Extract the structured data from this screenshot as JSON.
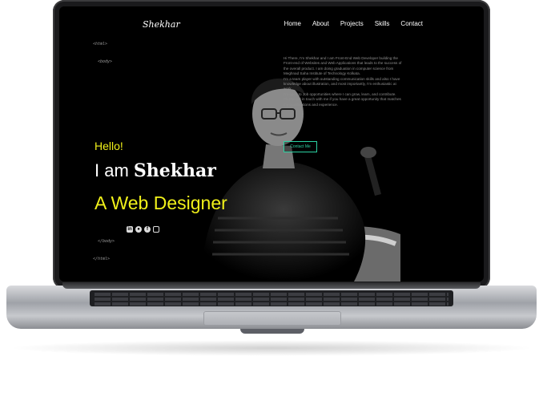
{
  "site": {
    "logo": "Shekhar",
    "nav": [
      "Home",
      "About",
      "Projects",
      "Skills",
      "Contact"
    ]
  },
  "hero": {
    "greeting": "Hello!",
    "intro_prefix": "I am",
    "name": "Shekhar",
    "role": "A Web Designer",
    "social_icons": [
      "linkedin-icon",
      "github-icon",
      "facebook-icon",
      "instagram-icon"
    ]
  },
  "code_tags": {
    "html_open": "<html>",
    "body_open": "<body>",
    "body_close": "</body>",
    "html_close": "</html>"
  },
  "about": {
    "lines": [
      "Hi There, I'm Shekhar and I am Front-End Web Developer building the",
      "Front-end of Websites and Web Applications that leads to the success of",
      "the overall product. I am doing graduation in computer science from",
      "Meghnad Saha Institute of Technology Kolkata.",
      "I'm a team player with outstanding communication skills and also I have",
      "knowledge about illustration, and most importantly, I'm enthusiastic at",
      "work.",
      "I'm open to Job opportunities where I can grow, learn, and contribute.",
      "Please get in touch with me if you have a great opportunity that matches",
      "my qualifications and experience."
    ],
    "cta_label": "Contact Me"
  },
  "colors": {
    "accent_yellow": "#f0f01a",
    "accent_teal": "#2bd1a2",
    "background": "#000000"
  }
}
